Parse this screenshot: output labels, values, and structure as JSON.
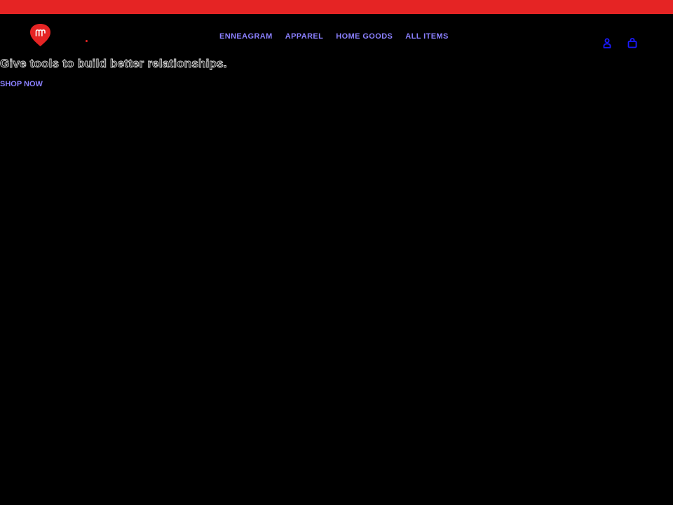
{
  "colors": {
    "background": "#000000",
    "announcement_bar": "#e52424",
    "accent_link": "#8b80ff",
    "icon": "#1a1aff",
    "logo": "#e52424"
  },
  "header": {
    "logo_icon": "heart-logo-icon",
    "nav": [
      {
        "label": "ENNEAGRAM"
      },
      {
        "label": "APPAREL"
      },
      {
        "label": "HOME GOODS"
      },
      {
        "label": "ALL ITEMS"
      }
    ],
    "icons": {
      "account": "user-icon",
      "cart": "shopping-bag-icon"
    }
  },
  "hero": {
    "heading": "Give tools to build better relationships.",
    "cta_label": "SHOP NOW"
  }
}
